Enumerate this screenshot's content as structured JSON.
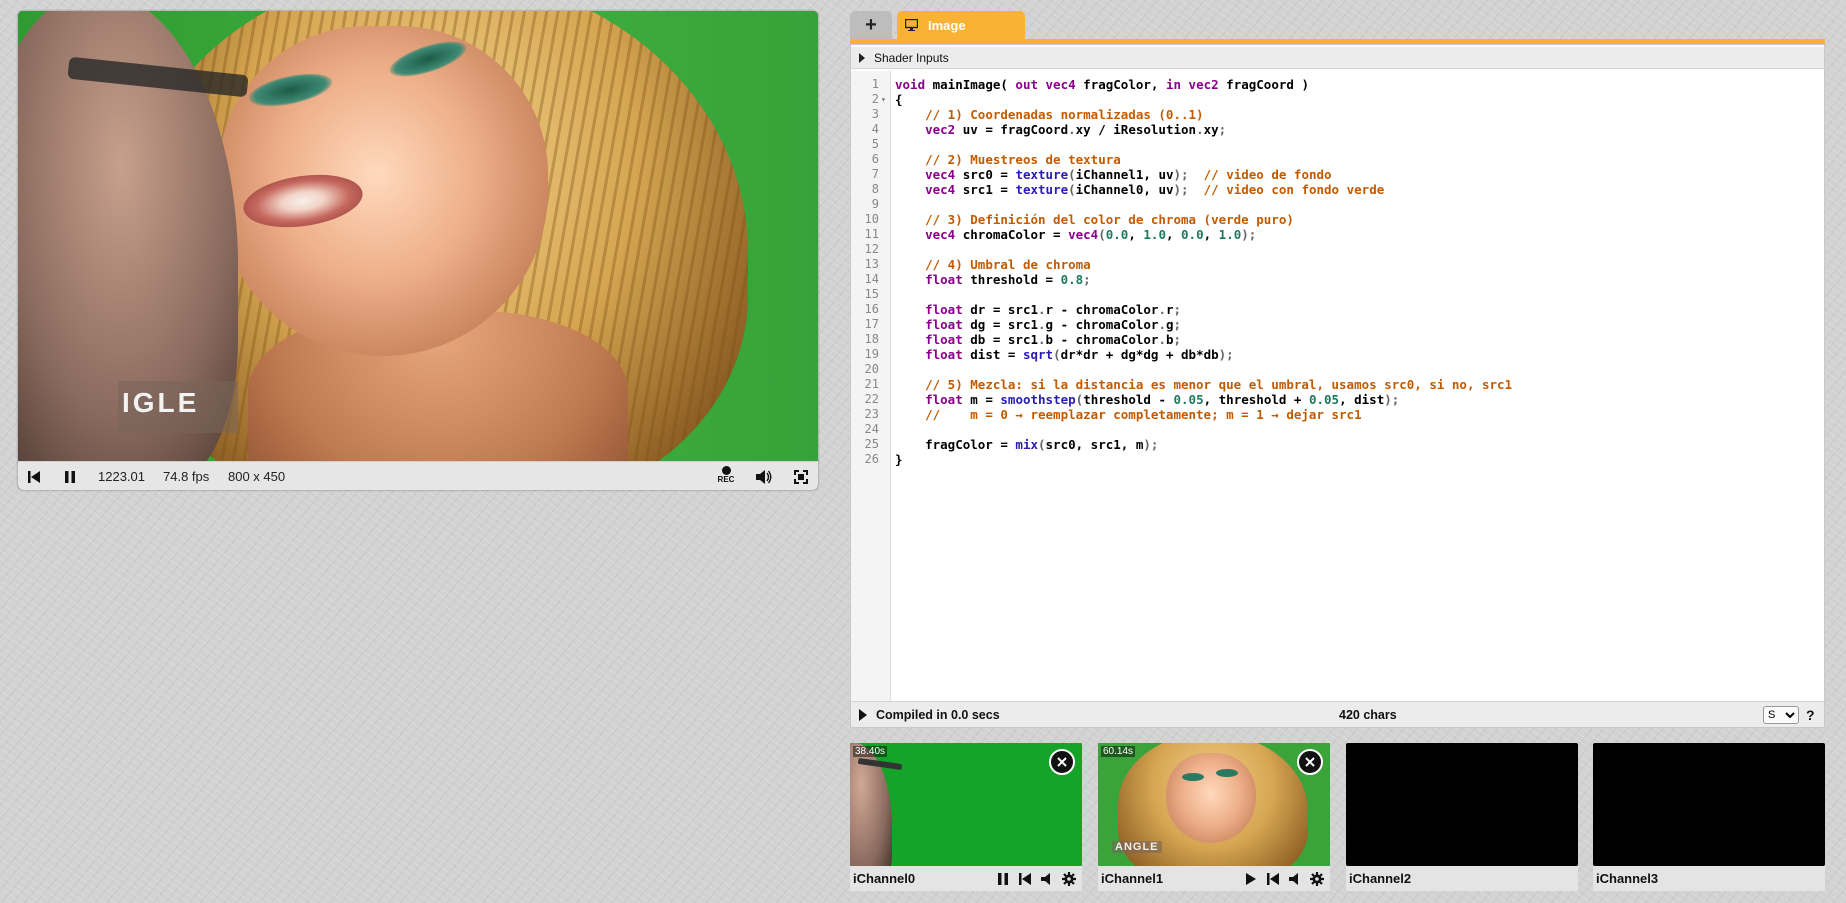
{
  "player": {
    "time": "1223.01",
    "fps": "74.8 fps",
    "resolution": "800 x 450",
    "rec_label": "REC",
    "overlay_logo": "IGLE"
  },
  "tabs": {
    "add_label": "+",
    "active_label": "Image"
  },
  "colors": {
    "accent": "#f9b233",
    "keyword": "#8b008b",
    "function": "#2a1bb3",
    "comment": "#c45a00",
    "number": "#1b7b5a"
  },
  "editor": {
    "shader_inputs_label": "Shader Inputs",
    "status": "Compiled in 0.0 secs",
    "chars": "420 chars",
    "font_size_option": "S",
    "help_label": "?",
    "code_lines": [
      [
        [
          "k",
          "void"
        ],
        [
          "x",
          " mainImage( "
        ],
        [
          "k",
          "out"
        ],
        [
          "x",
          " "
        ],
        [
          "k",
          "vec4"
        ],
        [
          "x",
          " fragColor, "
        ],
        [
          "k",
          "in"
        ],
        [
          "x",
          " "
        ],
        [
          "k",
          "vec2"
        ],
        [
          "x",
          " fragCoord )"
        ]
      ],
      [
        [
          "x",
          "{"
        ]
      ],
      [
        [
          "x",
          "    "
        ],
        [
          "c",
          "// 1) Coordenadas normalizadas (0..1)"
        ]
      ],
      [
        [
          "x",
          "    "
        ],
        [
          "k",
          "vec2"
        ],
        [
          "x",
          " uv = fragCoord"
        ],
        [
          "p",
          "."
        ],
        [
          "x",
          "xy / iResolution"
        ],
        [
          "p",
          "."
        ],
        [
          "x",
          "xy"
        ],
        [
          "p",
          ";"
        ]
      ],
      [
        [
          "x",
          ""
        ]
      ],
      [
        [
          "x",
          "    "
        ],
        [
          "c",
          "// 2) Muestreos de textura"
        ]
      ],
      [
        [
          "x",
          "    "
        ],
        [
          "k",
          "vec4"
        ],
        [
          "x",
          " src0 = "
        ],
        [
          "f",
          "texture"
        ],
        [
          "p",
          "("
        ],
        [
          "x",
          "iChannel1, uv"
        ],
        [
          "p",
          ");"
        ],
        [
          "x",
          "  "
        ],
        [
          "c",
          "// video de fondo"
        ]
      ],
      [
        [
          "x",
          "    "
        ],
        [
          "k",
          "vec4"
        ],
        [
          "x",
          " src1 = "
        ],
        [
          "f",
          "texture"
        ],
        [
          "p",
          "("
        ],
        [
          "x",
          "iChannel0, uv"
        ],
        [
          "p",
          ");"
        ],
        [
          "x",
          "  "
        ],
        [
          "c",
          "// video con fondo verde"
        ]
      ],
      [
        [
          "x",
          ""
        ]
      ],
      [
        [
          "x",
          "    "
        ],
        [
          "c",
          "// 3) Definición del color de chroma (verde puro)"
        ]
      ],
      [
        [
          "x",
          "    "
        ],
        [
          "k",
          "vec4"
        ],
        [
          "x",
          " chromaColor = "
        ],
        [
          "k",
          "vec4"
        ],
        [
          "p",
          "("
        ],
        [
          "n",
          "0.0"
        ],
        [
          "x",
          ", "
        ],
        [
          "n",
          "1.0"
        ],
        [
          "x",
          ", "
        ],
        [
          "n",
          "0.0"
        ],
        [
          "x",
          ", "
        ],
        [
          "n",
          "1.0"
        ],
        [
          "p",
          ");"
        ]
      ],
      [
        [
          "x",
          ""
        ]
      ],
      [
        [
          "x",
          "    "
        ],
        [
          "c",
          "// 4) Umbral de chroma"
        ]
      ],
      [
        [
          "x",
          "    "
        ],
        [
          "k",
          "float"
        ],
        [
          "x",
          " threshold = "
        ],
        [
          "n",
          "0.8"
        ],
        [
          "p",
          ";"
        ]
      ],
      [
        [
          "x",
          ""
        ]
      ],
      [
        [
          "x",
          "    "
        ],
        [
          "k",
          "float"
        ],
        [
          "x",
          " dr = src1"
        ],
        [
          "p",
          "."
        ],
        [
          "x",
          "r - chromaColor"
        ],
        [
          "p",
          "."
        ],
        [
          "x",
          "r"
        ],
        [
          "p",
          ";"
        ]
      ],
      [
        [
          "x",
          "    "
        ],
        [
          "k",
          "float"
        ],
        [
          "x",
          " dg = src1"
        ],
        [
          "p",
          "."
        ],
        [
          "x",
          "g - chromaColor"
        ],
        [
          "p",
          "."
        ],
        [
          "x",
          "g"
        ],
        [
          "p",
          ";"
        ]
      ],
      [
        [
          "x",
          "    "
        ],
        [
          "k",
          "float"
        ],
        [
          "x",
          " db = src1"
        ],
        [
          "p",
          "."
        ],
        [
          "x",
          "b - chromaColor"
        ],
        [
          "p",
          "."
        ],
        [
          "x",
          "b"
        ],
        [
          "p",
          ";"
        ]
      ],
      [
        [
          "x",
          "    "
        ],
        [
          "k",
          "float"
        ],
        [
          "x",
          " dist = "
        ],
        [
          "f",
          "sqrt"
        ],
        [
          "p",
          "("
        ],
        [
          "x",
          "dr*dr + dg*dg + db*db"
        ],
        [
          "p",
          ");"
        ]
      ],
      [
        [
          "x",
          ""
        ]
      ],
      [
        [
          "x",
          "    "
        ],
        [
          "c",
          "// 5) Mezcla: si la distancia es menor que el umbral, usamos src0, si no, src1"
        ]
      ],
      [
        [
          "x",
          "    "
        ],
        [
          "k",
          "float"
        ],
        [
          "x",
          " m = "
        ],
        [
          "f",
          "smoothstep"
        ],
        [
          "p",
          "("
        ],
        [
          "x",
          "threshold - "
        ],
        [
          "n",
          "0.05"
        ],
        [
          "x",
          ", threshold + "
        ],
        [
          "n",
          "0.05"
        ],
        [
          "x",
          ", dist"
        ],
        [
          "p",
          ");"
        ]
      ],
      [
        [
          "x",
          "    "
        ],
        [
          "c",
          "//    m = 0 → reemplazar completamente; m = 1 → dejar src1"
        ]
      ],
      [
        [
          "x",
          ""
        ]
      ],
      [
        [
          "x",
          "    fragColor = "
        ],
        [
          "f",
          "mix"
        ],
        [
          "p",
          "("
        ],
        [
          "x",
          "src0, src1, m"
        ],
        [
          "p",
          ");"
        ]
      ],
      [
        [
          "x",
          "}"
        ]
      ]
    ]
  },
  "channels": [
    {
      "label": "iChannel0",
      "time": "38.40s"
    },
    {
      "label": "iChannel1",
      "time": "60.14s"
    },
    {
      "label": "iChannel2"
    },
    {
      "label": "iChannel3"
    }
  ]
}
